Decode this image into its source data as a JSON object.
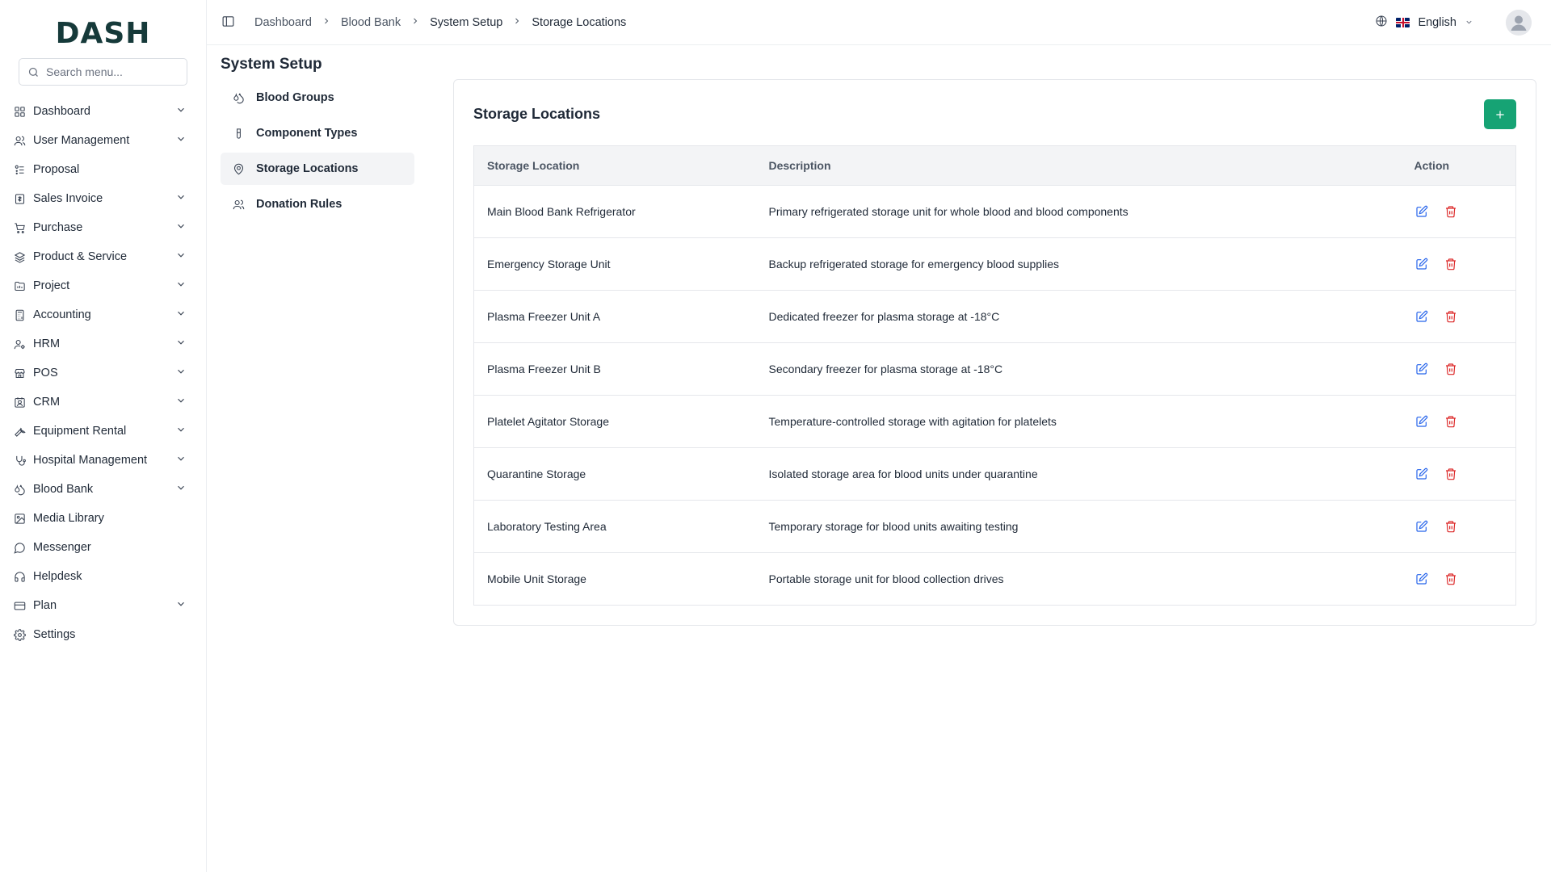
{
  "brand": {
    "logo_text": "DASH"
  },
  "search": {
    "placeholder": "Search menu..."
  },
  "sidebar": {
    "items": [
      {
        "label": "Dashboard",
        "icon": "grid-icon",
        "expandable": true
      },
      {
        "label": "User Management",
        "icon": "users-icon",
        "expandable": true
      },
      {
        "label": "Proposal",
        "icon": "proposal-icon",
        "expandable": false
      },
      {
        "label": "Sales Invoice",
        "icon": "invoice-icon",
        "expandable": true
      },
      {
        "label": "Purchase",
        "icon": "cart-icon",
        "expandable": true
      },
      {
        "label": "Product & Service",
        "icon": "layers-icon",
        "expandable": true
      },
      {
        "label": "Project",
        "icon": "folder-icon",
        "expandable": true
      },
      {
        "label": "Accounting",
        "icon": "calculator-icon",
        "expandable": true
      },
      {
        "label": "HRM",
        "icon": "user-cog-icon",
        "expandable": true
      },
      {
        "label": "POS",
        "icon": "store-icon",
        "expandable": true
      },
      {
        "label": "CRM",
        "icon": "contact-icon",
        "expandable": true
      },
      {
        "label": "Equipment Rental",
        "icon": "wrench-icon",
        "expandable": true
      },
      {
        "label": "Hospital Management",
        "icon": "stethoscope-icon",
        "expandable": true
      },
      {
        "label": "Blood Bank",
        "icon": "droplets-icon",
        "expandable": true
      },
      {
        "label": "Media Library",
        "icon": "image-icon",
        "expandable": false
      },
      {
        "label": "Messenger",
        "icon": "message-icon",
        "expandable": false
      },
      {
        "label": "Helpdesk",
        "icon": "headphones-icon",
        "expandable": false
      },
      {
        "label": "Plan",
        "icon": "credit-card-icon",
        "expandable": true
      },
      {
        "label": "Settings",
        "icon": "gear-icon",
        "expandable": false
      }
    ]
  },
  "breadcrumb": {
    "items": [
      {
        "label": "Dashboard",
        "current": false
      },
      {
        "label": "Blood Bank",
        "current": false
      },
      {
        "label": "System Setup",
        "current": false
      },
      {
        "label": "Storage Locations",
        "current": true
      }
    ]
  },
  "language": {
    "label": "English"
  },
  "page": {
    "title": "System Setup"
  },
  "subnav": {
    "items": [
      {
        "label": "Blood Groups",
        "icon": "droplets-icon",
        "active": false
      },
      {
        "label": "Component Types",
        "icon": "test-tube-icon",
        "active": false
      },
      {
        "label": "Storage Locations",
        "icon": "map-pin-icon",
        "active": true
      },
      {
        "label": "Donation Rules",
        "icon": "users-icon",
        "active": false
      }
    ]
  },
  "card": {
    "title": "Storage Locations",
    "add_icon": "plus-icon",
    "columns": [
      "Storage Location",
      "Description",
      "Action"
    ],
    "rows": [
      {
        "name": "Main Blood Bank Refrigerator",
        "description": "Primary refrigerated storage unit for whole blood and blood components"
      },
      {
        "name": "Emergency Storage Unit",
        "description": "Backup refrigerated storage for emergency blood supplies"
      },
      {
        "name": "Plasma Freezer Unit A",
        "description": "Dedicated freezer for plasma storage at -18°C"
      },
      {
        "name": "Plasma Freezer Unit B",
        "description": "Secondary freezer for plasma storage at -18°C"
      },
      {
        "name": "Platelet Agitator Storage",
        "description": "Temperature-controlled storage with agitation for platelets"
      },
      {
        "name": "Quarantine Storage",
        "description": "Isolated storage area for blood units under quarantine"
      },
      {
        "name": "Laboratory Testing Area",
        "description": "Temporary storage for blood units awaiting testing"
      },
      {
        "name": "Mobile Unit Storage",
        "description": "Portable storage unit for blood collection drives"
      }
    ]
  },
  "colors": {
    "accent": "#16a374",
    "edit": "#2563eb",
    "delete": "#dc2626",
    "logo": "#163a3a"
  }
}
